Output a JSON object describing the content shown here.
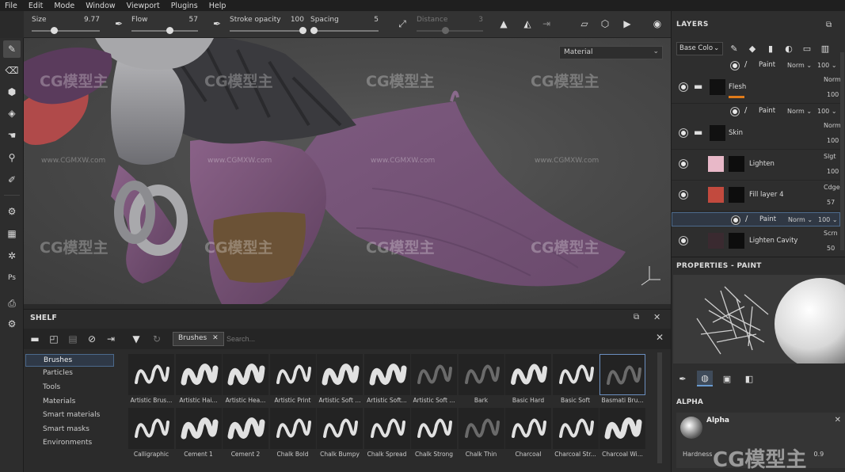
{
  "menu": [
    "File",
    "Edit",
    "Mode",
    "Window",
    "Viewport",
    "Plugins",
    "Help"
  ],
  "toolbar": {
    "size": {
      "label": "Size",
      "value": "9.77"
    },
    "flow": {
      "label": "Flow",
      "value": "57"
    },
    "stroke_opacity": {
      "label": "Stroke opacity",
      "value": "100"
    },
    "spacing": {
      "label": "Spacing",
      "value": "5"
    },
    "distance": {
      "label": "Distance",
      "value": "3"
    }
  },
  "viewport": {
    "material_select": "Material",
    "watermarks": [
      "CG模型主",
      "www.CGMXW.com"
    ]
  },
  "shelf": {
    "title": "SHELF",
    "active_tag": "Brushes",
    "search_placeholder": "Search...",
    "categories": [
      "Brushes",
      "Particles",
      "Tools",
      "Materials",
      "Smart materials",
      "Smart masks",
      "Environments"
    ],
    "brushes_row1": [
      "Artistic Brus...",
      "Artistic Hai...",
      "Artistic Hea...",
      "Artistic Print",
      "Artistic Soft ...",
      "Artistic Soft...",
      "Artistic Soft ...",
      "Bark",
      "Basic Hard",
      "Basic Soft",
      "Basmati Bru..."
    ],
    "brushes_row2": [
      "Calligraphic",
      "Cement 1",
      "Cement 2",
      "Chalk Bold",
      "Chalk Bumpy",
      "Chalk Spread",
      "Chalk Strong",
      "Chalk Thin",
      "Charcoal",
      "Charcoal Str...",
      "Charcoal Wi..."
    ]
  },
  "layers": {
    "title": "LAYERS",
    "channel": "Base Colo",
    "rows": [
      {
        "type": "sub",
        "name": "Paint",
        "blend": "Norm",
        "opacity": "100"
      },
      {
        "type": "layer",
        "name": "Flesh",
        "blend": "Norm",
        "opacity": "100",
        "kind": "folder"
      },
      {
        "type": "sub",
        "name": "Paint",
        "blend": "Norm",
        "opacity": "100"
      },
      {
        "type": "layer",
        "name": "Skin",
        "blend": "Norm",
        "opacity": "100",
        "kind": "folder"
      },
      {
        "type": "layer",
        "name": "Lighten",
        "blend": "Slgt",
        "opacity": "100",
        "kind": "fill"
      },
      {
        "type": "layer",
        "name": "Fill layer 4",
        "blend": "Cdge",
        "opacity": "57",
        "kind": "fill"
      },
      {
        "type": "sub",
        "name": "Paint",
        "blend": "Norm",
        "opacity": "100"
      },
      {
        "type": "layer",
        "name": "Lighten Cavity",
        "blend": "Scrn",
        "opacity": "50",
        "kind": "fill"
      }
    ]
  },
  "properties": {
    "title": "PROPERTIES - PAINT",
    "alpha_title": "ALPHA",
    "alpha_name": "Alpha",
    "hardness_label": "Hardness",
    "hardness_value": "0.9"
  },
  "colors": {
    "accent": "#e07b1a",
    "selection": "#6b8fbf",
    "skin": "#7a5578",
    "swatch_pink": "#e8b8c8",
    "swatch_red": "#c24a3e"
  }
}
